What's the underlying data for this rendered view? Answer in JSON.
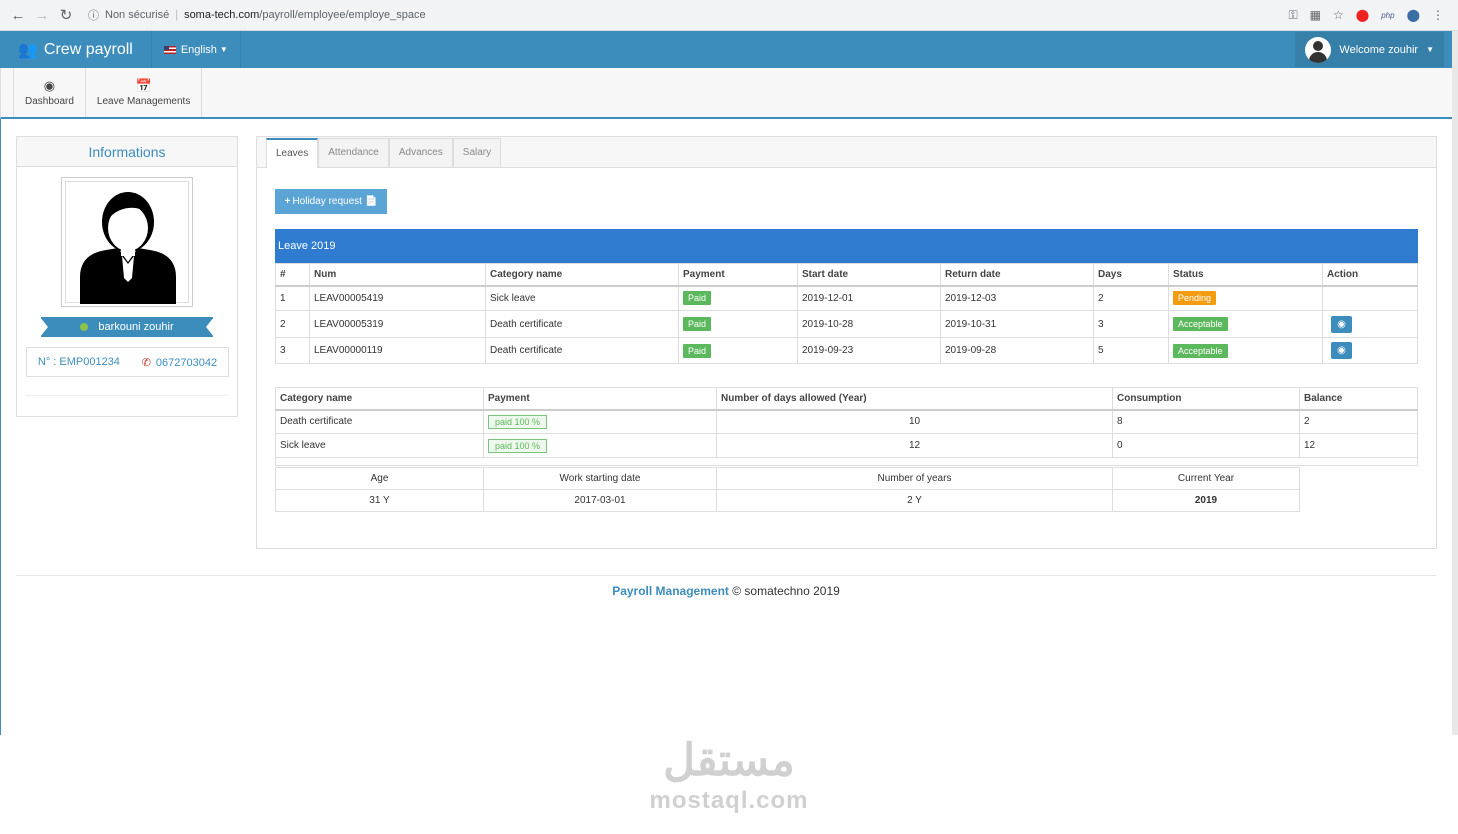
{
  "browser": {
    "security": "Non sécurisé",
    "url_host": "soma-tech.com",
    "url_path": "/payroll/employee/employe_space",
    "php": "php"
  },
  "header": {
    "brand": "Crew payroll",
    "language": "English",
    "welcome": "Welcome zouhir"
  },
  "subnav": [
    {
      "label": "Dashboard",
      "icon": "dashboard-icon"
    },
    {
      "label": "Leave Managements",
      "icon": "calendar-icon"
    }
  ],
  "profile": {
    "title": "Informations",
    "name": "barkouni zouhir",
    "number": "N° : EMP001234",
    "phone": "0672703042"
  },
  "tabs": [
    "Leaves",
    "Attendance",
    "Advances",
    "Salary"
  ],
  "holiday_button": "Holiday request",
  "leave_title": "Leave 2019",
  "leaves": {
    "headers": [
      "#",
      "Num",
      "Category name",
      "Payment",
      "Start date",
      "Return date",
      "Days",
      "Status",
      "Action"
    ],
    "rows": [
      {
        "n": "1",
        "num": "LEAV00005419",
        "cat": "Sick leave",
        "pay": "Paid",
        "start": "2019-12-01",
        "ret": "2019-12-03",
        "days": "2",
        "status": "Pending"
      },
      {
        "n": "2",
        "num": "LEAV00005319",
        "cat": "Death certificate",
        "pay": "Paid",
        "start": "2019-10-28",
        "ret": "2019-10-31",
        "days": "3",
        "status": "Acceptable"
      },
      {
        "n": "3",
        "num": "LEAV00000119",
        "cat": "Death certificate",
        "pay": "Paid",
        "start": "2019-09-23",
        "ret": "2019-09-28",
        "days": "5",
        "status": "Acceptable"
      }
    ]
  },
  "balance": {
    "headers": [
      "Category name",
      "Payment",
      "Number of days allowed (Year)",
      "Consumption",
      "Balance"
    ],
    "rows": [
      {
        "cat": "Death certificate",
        "pay": "paid 100 %",
        "allowed": "10",
        "cons": "8",
        "bal": "2"
      },
      {
        "cat": "Sick leave",
        "pay": "paid 100 %",
        "allowed": "12",
        "cons": "0",
        "bal": "12"
      }
    ]
  },
  "summary": {
    "headers": [
      "Age",
      "Work starting date",
      "Number of years",
      "Current Year"
    ],
    "values": [
      "31 Y",
      "2017-03-01",
      "2 Y",
      "2019"
    ]
  },
  "footer": {
    "brand": "Payroll Management",
    "rest": "© somatechno 2019"
  },
  "watermark": {
    "arabic": "مستقل",
    "latin": "mostaql.com"
  }
}
